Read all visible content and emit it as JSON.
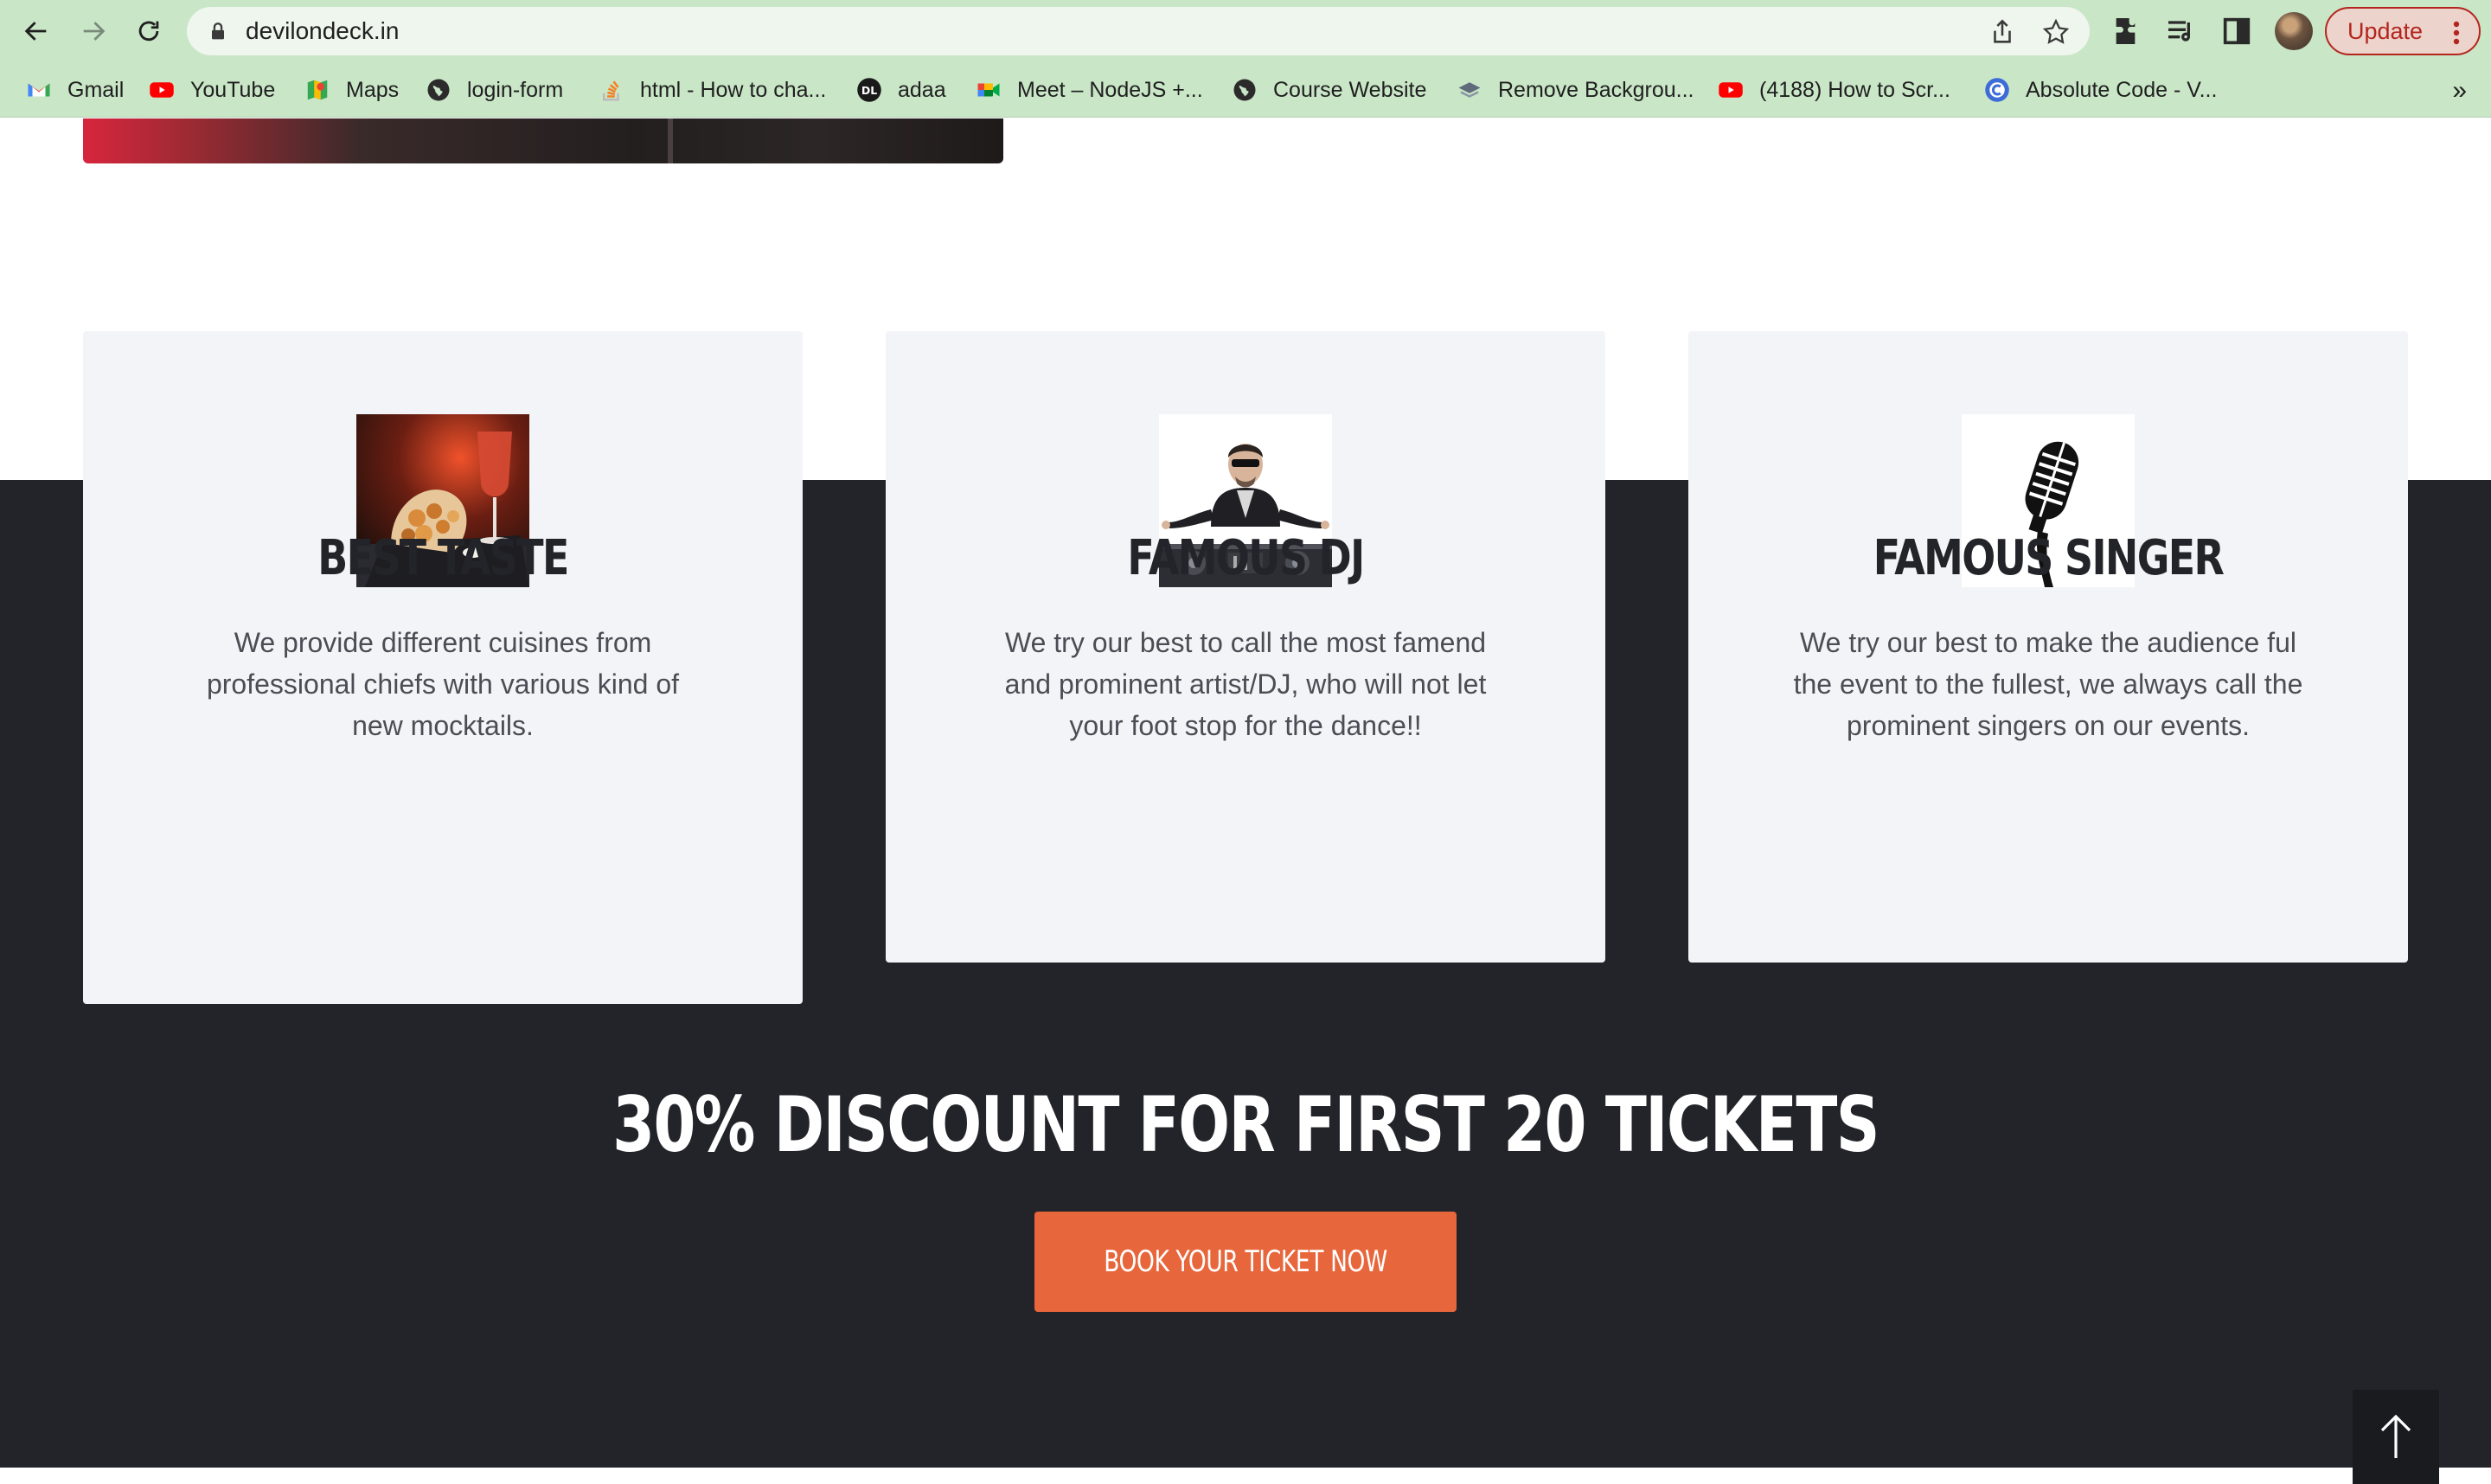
{
  "browser": {
    "url": "devilondeck.in",
    "update_label": "Update",
    "bookmarks": [
      {
        "label": "Gmail",
        "icon": "gmail-icon"
      },
      {
        "label": "YouTube",
        "icon": "youtube-icon"
      },
      {
        "label": "Maps",
        "icon": "maps-icon"
      },
      {
        "label": "login-form",
        "icon": "globe-icon"
      },
      {
        "label": "html - How to cha...",
        "icon": "stackoverflow-icon"
      },
      {
        "label": "adaa",
        "icon": "dl-icon"
      },
      {
        "label": "Meet – NodeJS +...",
        "icon": "meet-icon"
      },
      {
        "label": "Course Website",
        "icon": "globe-icon"
      },
      {
        "label": "Remove Backgrou...",
        "icon": "layers-icon"
      },
      {
        "label": "(4188) How to Scr...",
        "icon": "youtube-icon"
      },
      {
        "label": "Absolute Code - V...",
        "icon": "absolute-code-icon"
      }
    ]
  },
  "features": [
    {
      "title": "BEST TASTE",
      "description": "We provide different cuisines from professional chiefs with various kind of new mocktails.",
      "image": "food-and-drink-photo"
    },
    {
      "title": "FAMOUS DJ",
      "description": "We try our best to call the most famend and prominent artist/DJ, who will not let your foot stop for the dance!!",
      "image": "dj-photo"
    },
    {
      "title": "FAMOUS SINGER",
      "description": "We try our best to make the audience ful the event to the fullest, we always call the prominent singers on our events.",
      "image": "microphone-icon"
    }
  ],
  "promo": {
    "headline": "30% DISCOUNT FOR FIRST 20 TICKETS",
    "button_label": "BOOK YOUR TICKET NOW"
  },
  "colors": {
    "chrome": "#c9e6c7",
    "dark_band": "#232429",
    "card_bg": "#f3f4f7",
    "accent": "#e8663b"
  }
}
